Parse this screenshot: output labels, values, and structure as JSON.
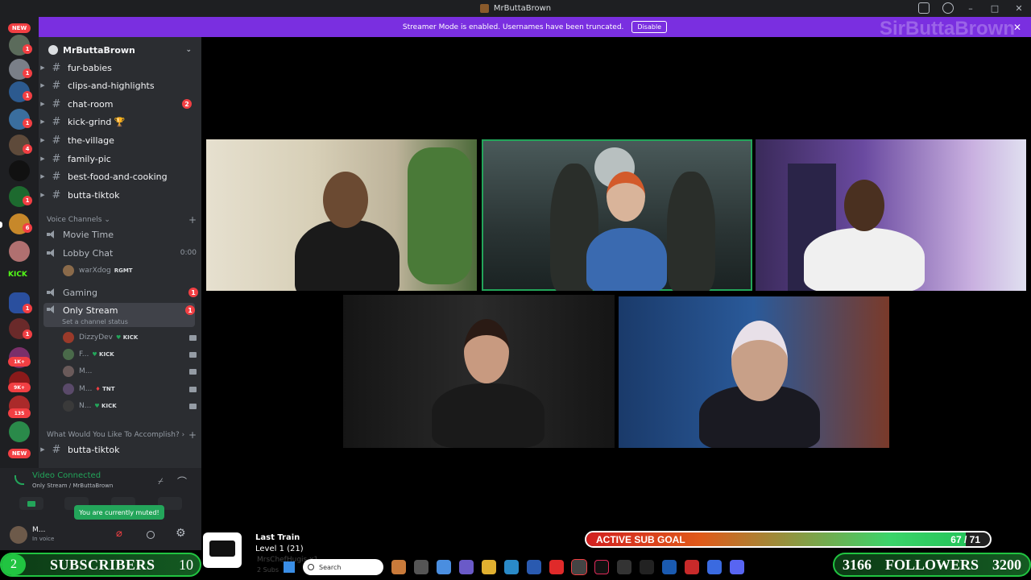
{
  "window": {
    "title": "MrButtaBrown"
  },
  "streamer_banner": {
    "text": "Streamer Mode is enabled. Usernames have been truncated.",
    "button": "Disable",
    "watermark": "SirButtaBrown"
  },
  "server_rail": {
    "badges": [
      "NEW",
      "1",
      "1",
      "1",
      "1",
      "4",
      "1",
      "6",
      "KICK",
      "1",
      "1",
      "1K+",
      "9K+",
      "135",
      "NEW"
    ]
  },
  "server": {
    "name": "MrButtaBrown"
  },
  "channels": [
    {
      "name": "fur-babies"
    },
    {
      "name": "clips-and-highlights"
    },
    {
      "name": "chat-room",
      "count": "2"
    },
    {
      "name": "kick-grind 🏆"
    },
    {
      "name": "the-village"
    },
    {
      "name": "family-pic"
    },
    {
      "name": "best-food-and-cooking"
    },
    {
      "name": "butta-tiktok"
    }
  ],
  "voice_category": "Voice Channels",
  "voice_channels": {
    "movie_time": "Movie Time",
    "lobby_chat": "Lobby Chat",
    "lobby_time": "0:00",
    "lobby_user": "warXdog",
    "lobby_user_tag": "RGMT",
    "gaming": "Gaming",
    "gaming_count": "1",
    "only_stream": "Only Stream",
    "only_stream_count": "1",
    "only_stream_status": "Set a channel status"
  },
  "stream_users": [
    {
      "name": "DizzyDev",
      "tag": "KICK"
    },
    {
      "name": "F...",
      "tag": "KICK"
    },
    {
      "name": "M...",
      "tag": ""
    },
    {
      "name": "M...",
      "tag": "TNT"
    },
    {
      "name": "N...",
      "tag": "KICK"
    }
  ],
  "category2": "What Would You Like To Accomplish?",
  "channel_after": "butta-tiktok",
  "voice_panel": {
    "title": "Video Connected",
    "sub": "Only Stream / MrButtaBrown",
    "tooltip": "You are currently muted!"
  },
  "user_panel": {
    "name": "M...",
    "status": "In voice"
  },
  "overlay": {
    "subs": {
      "count": "2",
      "label": "SUBSCRIBERS",
      "goal": "10"
    },
    "train": {
      "title": "Last Train",
      "level": "Level 1 (21)",
      "sub1": "MrsChefHugis x1",
      "sub2": "2 Subs"
    },
    "goal": {
      "label": "ACTIVE SUB GOAL",
      "count": "67 / 71",
      "fraction": 0.94
    },
    "followers": {
      "count": "3166",
      "label": "FOLLOWERS",
      "goal": "3200"
    }
  },
  "taskbar": {
    "search": "Search"
  },
  "colors": {
    "accent": "#7a2fe0",
    "green": "#23a55a",
    "red": "#f23f43"
  }
}
